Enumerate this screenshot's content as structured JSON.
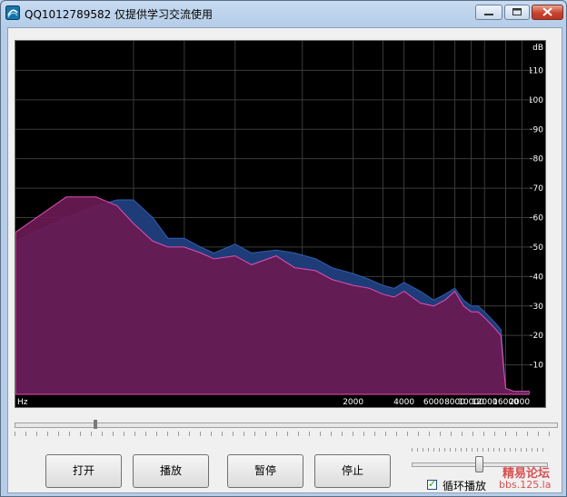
{
  "window": {
    "title": "QQ1012789582  仅提供学习交流使用"
  },
  "spectrum": {
    "unit_db": "dB",
    "unit_hz": "Hz",
    "db_ticks": [
      "110",
      "100",
      "90",
      "80",
      "70",
      "60",
      "50",
      "40",
      "30",
      "20",
      "10"
    ],
    "freq_ticks": [
      "2000",
      "4000",
      "6000",
      "8000",
      "10000",
      "12000",
      "16000",
      "20000"
    ],
    "colors": {
      "background": "#000000",
      "channel_a": "#1e3c78",
      "channel_b": "#6a1a52",
      "channel_b_edge": "#e050b0",
      "grid": "#3b3b3b"
    }
  },
  "chart_data": {
    "type": "area",
    "xlabel": "Hz",
    "ylabel": "dB",
    "ylim": [
      0,
      120
    ],
    "xscale": "log",
    "x": [
      20,
      40,
      60,
      80,
      100,
      130,
      160,
      200,
      250,
      300,
      400,
      500,
      700,
      900,
      1200,
      1500,
      2000,
      2500,
      3000,
      3500,
      4000,
      5000,
      6000,
      7000,
      8000,
      9000,
      10000,
      11000,
      12000,
      13000,
      14000,
      15000,
      15500,
      16000,
      18000,
      20000,
      22000
    ],
    "series": [
      {
        "name": "",
        "values": [
          52,
          60,
          64,
          66,
          66,
          60,
          53,
          53,
          50,
          48,
          51,
          48,
          49,
          48,
          46,
          43,
          41,
          39,
          37,
          36,
          38,
          35,
          32,
          34,
          36,
          32,
          30,
          30,
          28,
          26,
          24,
          22,
          12,
          2,
          1,
          1,
          1
        ]
      },
      {
        "name": "",
        "values": [
          55,
          67,
          67,
          64,
          58,
          52,
          50,
          50,
          48,
          46,
          47,
          44,
          47,
          43,
          42,
          39,
          37,
          36,
          34,
          33,
          35,
          31,
          30,
          32,
          35,
          30,
          28,
          28,
          26,
          24,
          22,
          20,
          10,
          2,
          1,
          1,
          1
        ]
      }
    ]
  },
  "seek": {
    "position_fraction": 0.15
  },
  "buttons": {
    "open": "打开",
    "play": "播放",
    "pause": "暂停",
    "stop": "停止"
  },
  "volume": {
    "level_fraction": 0.5
  },
  "loop": {
    "label": "循环播放",
    "checked": true,
    "check_glyph": "✓"
  },
  "watermark": {
    "line1": "精易论坛",
    "line2": "bbs.125.la"
  },
  "icons": {
    "app": "app-logo-icon",
    "minimize": "minimize-icon",
    "maximize": "maximize-icon",
    "close": "close-icon"
  }
}
